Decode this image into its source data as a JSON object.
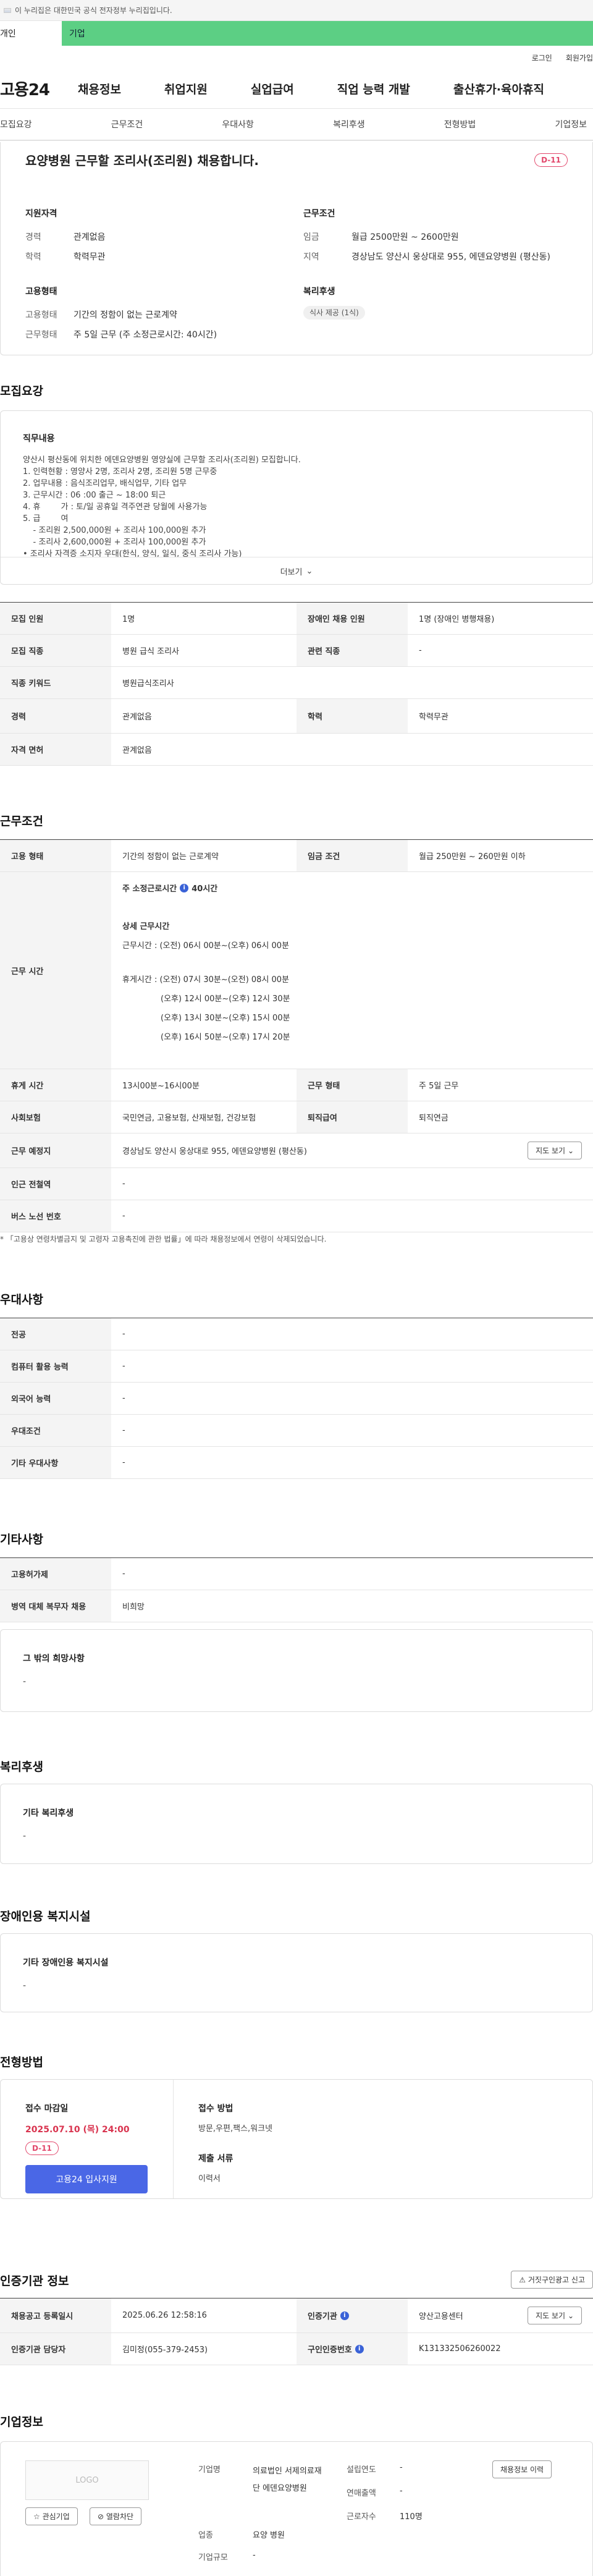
{
  "gov_bar": {
    "text": "이 누리집은 대한민국 공식 전자정부 누리집입니다."
  },
  "user_type": {
    "individual": "개인",
    "company": "기업"
  },
  "top_links": {
    "login": "로그인",
    "join": "회원가입"
  },
  "gnb": {
    "logo": "고용24",
    "items": [
      "채용정보",
      "취업지원",
      "실업급여",
      "직업 능력 개발",
      "출산휴가·육아휴직"
    ]
  },
  "tabs": [
    "모집요강",
    "근무조건",
    "우대사항",
    "복리후생",
    "전형방법",
    "기업정보"
  ],
  "summary": {
    "title": "요양병원 근무할 조리사(조리원) 채용합니다.",
    "dday": "D-11",
    "qual_title": "지원자격",
    "career_label": "경력",
    "career": "관계없음",
    "edu_label": "학력",
    "edu": "학력무관",
    "cond_title": "근무조건",
    "wage_label": "임금",
    "wage": "월급 2500만원 ~ 2600만원",
    "area_label": "지역",
    "area": "경상남도 양산시 웅상대로 955, 에덴요양병원 (평산동)",
    "emp_title": "고용형태",
    "emp_label": "고용형태",
    "emp": "기간의 정함이 없는 근로계약",
    "worktype_label": "근무형태",
    "worktype": "주 5일 근무 (주 소정근로시간: 40시간)",
    "welfare_title": "복리후생",
    "welfare_chip": "식사 제공 (1식)"
  },
  "recruit": {
    "section_title": "모집요강",
    "duty_title": "직무내용",
    "duty_lines": [
      "양산시 평산동에 위치한 에덴요양병원 영양실에 근무할 조리사(조리원) 모집합니다.",
      "1. 인력현황 : 영양사 2명, 조리사 2명, 조리원 5명 근무중",
      "2. 업무내용 : 음식조리업무, 배식업무, 기타 업무",
      "3. 근무시간 : 06 :00 출근 ~ 18:00 퇴근",
      "4. 휴        가 : 토/일 공휴일 격주연관 당월에 사용가능",
      "5. 급        여",
      "    - 조리원 2,500,000원 + 조리사 100,000원 추가",
      "    - 조리사 2,600,000원 + 조리사 100,000원 추가",
      "• 조리사 자격증 소지자 우대(한식, 양식, 일식, 중식 조리사 가능)"
    ],
    "more": "더보기",
    "rows": [
      {
        "k": "모집 인원",
        "v": "1명",
        "k2": "장애인 채용 인원",
        "v2": "1명 (장애인 병행채용)"
      },
      {
        "k": "모집 직종",
        "v": "병원 급식 조리사",
        "k2": "관련 직종",
        "v2": "-"
      },
      {
        "k": "직종 키워드",
        "v": "병원급식조리사"
      },
      {
        "k": "경력",
        "v": "관계없음",
        "k2": "학력",
        "v2": "학력무관"
      },
      {
        "k": "자격 면허",
        "v": "관계없음"
      }
    ]
  },
  "work": {
    "section_title": "근무조건",
    "emp_k": "고용 형태",
    "emp_v": "기간의 정함이 없는 근로계약",
    "wage_k": "임금 조건",
    "wage_v": "월급 250만원 ~ 260만원 이하",
    "time_k": "근무 시간",
    "hours_title": "주 소정근로시간",
    "hours_info": "i",
    "hours_v": "40시간",
    "detail_title": "상세 근무시간",
    "detail_line": "근무시간 : (오전) 06시 00분~(오후) 06시 00분",
    "break_lines": [
      "휴게시간 : (오전) 07시 30분~(오전) 08시 00분",
      "(오후) 12시 00분~(오후) 12시 30분",
      "(오후) 13시 30분~(오후) 15시 00분",
      "(오후) 16시 50분~(오후) 17시 20분"
    ],
    "break_k": "휴게 시간",
    "break_v": "13시00분~16시00분",
    "form_k": "근무 형태",
    "form_v": "주 5일 근무",
    "ins_k": "사회보험",
    "ins_v": "국민연금, 고용보험, 산재보험, 건강보험",
    "ret_k": "퇴직급여",
    "ret_v": "퇴직연금",
    "place_k": "근무 예정지",
    "place_v": "경상남도 양산시 웅상대로 955, 에덴요양병원 (평산동)",
    "map_btn": "지도 보기",
    "subway_k": "인근 전철역",
    "subway_v": "-",
    "bus_k": "버스 노선 번호",
    "bus_v": "-",
    "note": "* 「고용상 연령차별금지 및 고령자 고용촉진에 관한 법률」에 따라 채용정보에서 연령이 삭제되었습니다."
  },
  "pref": {
    "section_title": "우대사항",
    "rows": [
      {
        "k": "전공",
        "v": "-"
      },
      {
        "k": "컴퓨터 활용 능력",
        "v": "-"
      },
      {
        "k": "외국어 능력",
        "v": "-"
      },
      {
        "k": "우대조건",
        "v": "-"
      },
      {
        "k": "기타 우대사항",
        "v": "-"
      }
    ]
  },
  "etc": {
    "section_title": "기타사항",
    "rows": [
      {
        "k": "고용허가제",
        "v": "-"
      },
      {
        "k": "병역 대체 복무자 채용",
        "v": "비희망"
      }
    ],
    "other_title": "그 밖의 희망사항",
    "other_v": "-"
  },
  "welfare": {
    "section_title": "복리후생",
    "t": "기타 복리후생",
    "v": "-"
  },
  "disab": {
    "section_title": "장애인용 복지시설",
    "t": "기타 장애인용 복지시설",
    "v": "-"
  },
  "apply": {
    "section_title": "전형방법",
    "deadline_t": "접수 마감일",
    "deadline_v": "2025.07.10 (목) 24:00",
    "dday": "D-11",
    "apply_btn": "고용24 입사지원",
    "method_t": "접수 방법",
    "method_v": "방문,우편,팩스,워크넷",
    "docs_t": "제출 서류",
    "docs_v": "이력서"
  },
  "cert": {
    "section_title": "인증기관 정보",
    "report_btn": "거짓구인광고 신고",
    "r1": {
      "k": "채용공고 등록일시",
      "v": "2025.06.26 12:58:16",
      "k2": "인증기관",
      "info": "i",
      "v2": "양산고용센터",
      "btn": "지도 보기"
    },
    "r2": {
      "k": "인증기관 담당자",
      "v": "김미정(055-379-2453)",
      "k2": "구인인증번호",
      "info": "i",
      "v2": "K131332506260022"
    }
  },
  "company": {
    "section_title": "기업정보",
    "logo": "LOGO",
    "fav_btn": "관심기업",
    "block_btn": "열람차단",
    "name_k": "기업명",
    "name_v": "의료법인 서제의료재단 에덴요양병원",
    "ind_k": "업종",
    "ind_v": "요양 병원",
    "size_k": "기업규모",
    "size_v": "-",
    "year_k": "설립연도",
    "year_v": "-",
    "sales_k": "연매출액",
    "sales_v": "-",
    "emp_k": "근로자수",
    "emp_v": "110명",
    "more_btn": "채용정보 이력"
  }
}
